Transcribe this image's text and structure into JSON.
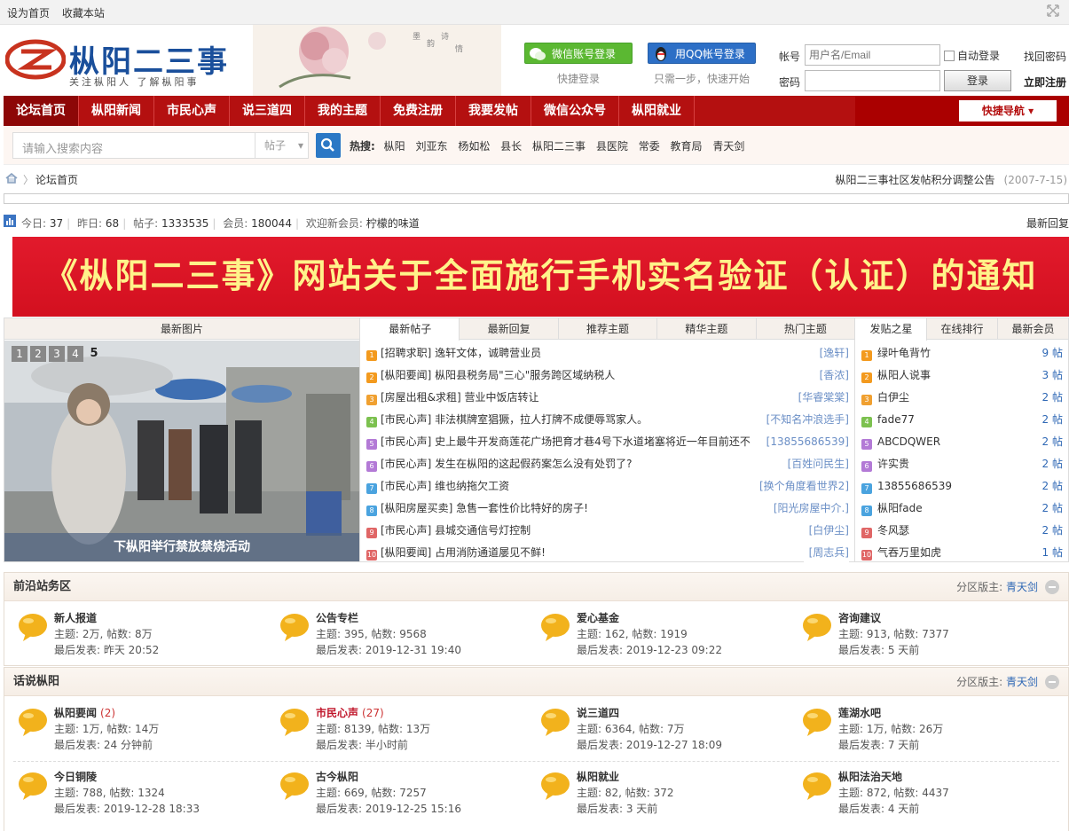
{
  "topbar": {
    "set_home": "设为首页",
    "bookmark": "收藏本站"
  },
  "logo": {
    "name": "枞阳二三事",
    "slogan": "关注枞阳人 了解枞阳事"
  },
  "social": {
    "wechat_btn": "微信账号登录",
    "wechat_sub": "快捷登录",
    "qq_btn": "用QQ帐号登录",
    "qq_sub": "只需一步，快速开始"
  },
  "login": {
    "account_label": "帐号",
    "account_placeholder": "用户名/Email",
    "password_label": "密码",
    "auto_login": "自动登录",
    "forgot": "找回密码",
    "login_btn": "登录",
    "register": "立即注册"
  },
  "nav": {
    "items": [
      "论坛首页",
      "枞阳新闻",
      "市民心声",
      "说三道四",
      "我的主题",
      "免费注册",
      "我要发帖",
      "微信公众号",
      "枞阳就业"
    ],
    "quick": "快捷导航"
  },
  "search": {
    "placeholder": "请输入搜索内容",
    "type": "帖子",
    "hot_label": "热搜:",
    "hot": [
      "枞阳",
      "刘亚东",
      "杨如松",
      "县长",
      "枞阳二三事",
      "县医院",
      "常委",
      "教育局",
      "青天剑"
    ]
  },
  "crumb": {
    "home": "论坛首页",
    "notice": "枞阳二三事社区发帖积分调整公告",
    "notice_date": "(2007-7-15)"
  },
  "stats": {
    "today_label": "今日:",
    "today": "37",
    "yesterday_label": "昨日:",
    "yesterday": "68",
    "posts_label": "帖子:",
    "posts": "1333535",
    "members_label": "会员:",
    "members": "180044",
    "welcome_label": "欢迎新会员:",
    "newest": "柠檬的味道",
    "latest_reply": "最新回复"
  },
  "banner": {
    "text": "《枞阳二三事》网站关于全面施行手机实名验证（认证）的通知"
  },
  "portal": {
    "pic_title": "最新图片",
    "pic_pages": [
      "1",
      "2",
      "3",
      "4",
      "5"
    ],
    "pic_caption": "下枞阳举行禁放禁烧活动",
    "post_tabs": [
      "最新帖子",
      "最新回复",
      "推荐主题",
      "精华主题",
      "热门主题"
    ],
    "posts": [
      {
        "n": "1",
        "title": "[招聘求职] 逸轩文体，诚聘营业员",
        "author": "[逸轩]"
      },
      {
        "n": "2",
        "title": "[枞阳要闻] 枞阳县税务局\"三心\"服务跨区域纳税人",
        "author": "[香浓]"
      },
      {
        "n": "3",
        "title": "[房屋出租&求租] 营业中饭店转让",
        "author": "[华睿棠棠]"
      },
      {
        "n": "4",
        "title": "[市民心声] 非法棋牌室猖獗，拉人打牌不成便辱骂家人。",
        "author": "[不知名冲浪选手]"
      },
      {
        "n": "5",
        "title": "[市民心声] 史上最牛开发商莲花广场把育才巷4号下水道堵塞将近一年目前还不",
        "author": "[13855686539]"
      },
      {
        "n": "6",
        "title": "[市民心声] 发生在枞阳的这起假药案怎么没有处罚了?",
        "author": "[百姓问民生]"
      },
      {
        "n": "7",
        "title": "[市民心声] 维也纳拖欠工资",
        "author": "[换个角度看世界2]"
      },
      {
        "n": "8",
        "title": "[枞阳房屋买卖] 急售一套性价比特好的房子!",
        "author": "[阳光房屋中介.]"
      },
      {
        "n": "9",
        "title": "[市民心声] 县城交通信号灯控制",
        "author": "[白伊尘]"
      },
      {
        "n": "10",
        "title": "[枞阳要闻] 占用消防通道屡见不鲜!",
        "author": "[周志兵]"
      }
    ],
    "star_tabs": [
      "发贴之星",
      "在线排行",
      "最新会员"
    ],
    "stars": [
      {
        "n": "1",
        "name": "绿叶龟背竹",
        "count": "9 帖"
      },
      {
        "n": "2",
        "name": "枞阳人说事",
        "count": "3 帖"
      },
      {
        "n": "3",
        "name": "白伊尘",
        "count": "2 帖"
      },
      {
        "n": "4",
        "name": "fade77",
        "count": "2 帖"
      },
      {
        "n": "5",
        "name": "ABCDQWER",
        "count": "2 帖"
      },
      {
        "n": "6",
        "name": "许实贵",
        "count": "2 帖"
      },
      {
        "n": "7",
        "name": "13855686539",
        "count": "2 帖"
      },
      {
        "n": "8",
        "name": "枞阳fade",
        "count": "2 帖"
      },
      {
        "n": "9",
        "name": "冬风瑟",
        "count": "2 帖"
      },
      {
        "n": "10",
        "name": "气吞万里如虎",
        "count": "1 帖"
      }
    ]
  },
  "sections": [
    {
      "title": "前沿站务区",
      "mod_label": "分区版主:",
      "mod": "青天剑",
      "forums": [
        {
          "name": "新人报道",
          "extra": "",
          "stats": "主题: 2万, 帖数: 8万",
          "last": "最后发表: 昨天 20:52"
        },
        {
          "name": "公告专栏",
          "extra": "",
          "stats": "主题: 395, 帖数: 9568",
          "last": "最后发表: 2019-12-31 19:40"
        },
        {
          "name": "爱心基金",
          "extra": "",
          "stats": "主题: 162, 帖数: 1919",
          "last": "最后发表: 2019-12-23 09:22"
        },
        {
          "name": "咨询建议",
          "extra": "",
          "stats": "主题: 913, 帖数: 7377",
          "last": "最后发表: 5 天前"
        }
      ]
    },
    {
      "title": "话说枞阳",
      "mod_label": "分区版主:",
      "mod": "青天剑",
      "forums": [
        {
          "name": "枞阳要闻",
          "extra": "(2)",
          "stats": "主题: 1万, 帖数: 14万",
          "last": "最后发表: 24 分钟前"
        },
        {
          "name": "市民心声",
          "extra": "(27)",
          "stats": "主题: 8139, 帖数: 13万",
          "last": "最后发表: 半小时前"
        },
        {
          "name": "说三道四",
          "extra": "",
          "stats": "主题: 6364, 帖数: 7万",
          "last": "最后发表: 2019-12-27 18:09"
        },
        {
          "name": "莲湖水吧",
          "extra": "",
          "stats": "主题: 1万, 帖数: 26万",
          "last": "最后发表: 7 天前"
        },
        {
          "name": "今日铜陵",
          "extra": "",
          "stats": "主题: 788, 帖数: 1324",
          "last": "最后发表: 2019-12-28 18:33"
        },
        {
          "name": "古今枞阳",
          "extra": "",
          "stats": "主题: 669, 帖数: 7257",
          "last": "最后发表: 2019-12-25 15:16"
        },
        {
          "name": "枞阳就业",
          "extra": "",
          "stats": "主题: 82, 帖数: 372",
          "last": "最后发表: 3 天前"
        },
        {
          "name": "枞阳法治天地",
          "extra": "",
          "stats": "主题: 872, 帖数: 4437",
          "last": "最后发表: 4 天前"
        }
      ]
    }
  ],
  "colors": {
    "nav": "#b41010",
    "link": "#2f68b5",
    "banner": "#e21a2c"
  }
}
